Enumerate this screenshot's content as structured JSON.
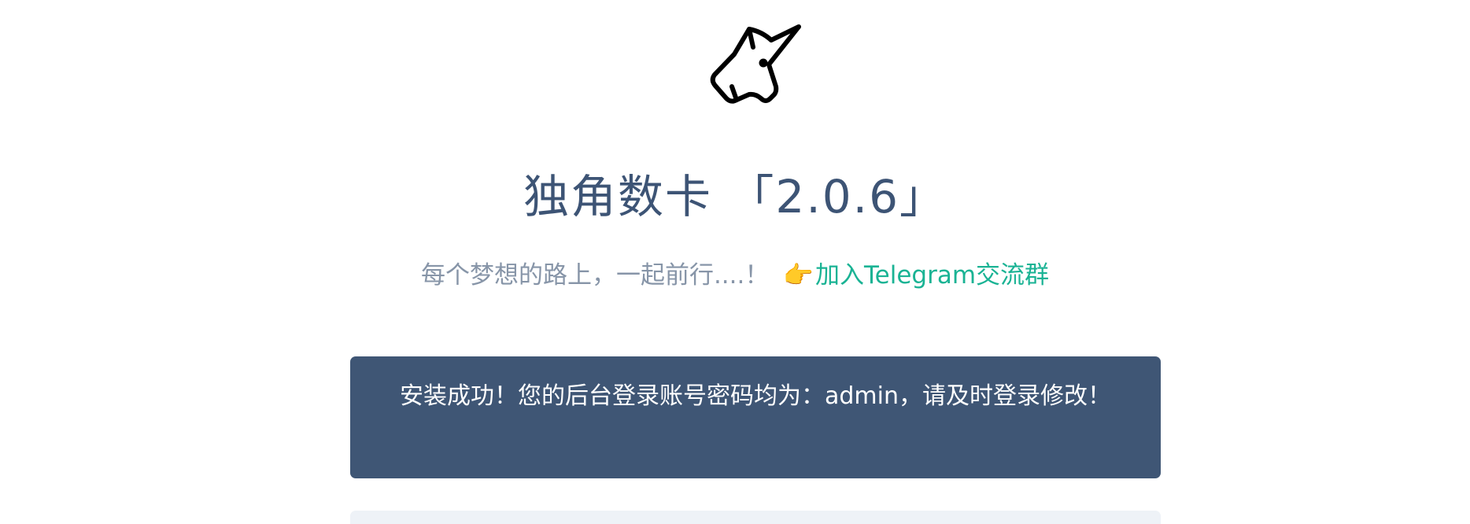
{
  "header": {
    "logo_icon": "unicorn-head-icon",
    "title": "独角数卡 「2.0.6」",
    "tagline": "每个梦想的路上，一起前行....！",
    "pointer_emoji": "👉",
    "telegram_link_label": "加入Telegram交流群"
  },
  "notice": {
    "message": "安装成功！您的后台登录账号密码均为：admin，请及时登录修改！"
  },
  "colors": {
    "title": "#3d5475",
    "tagline": "#8795a8",
    "link": "#1ab394",
    "notice_bg": "#3f5675",
    "panel_bg": "#eef2f7"
  }
}
